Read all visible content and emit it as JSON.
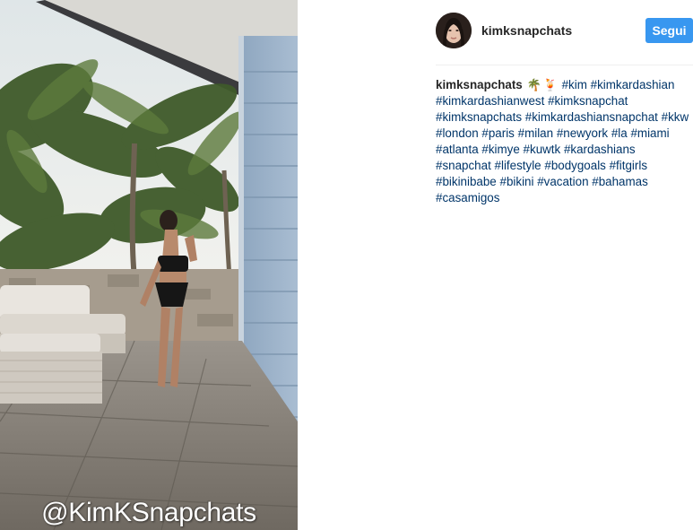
{
  "post": {
    "username": "kimksnapchats",
    "follow_label": "Segui",
    "watermark": "@KimKSnapchats",
    "avatar_icon": "profile-avatar",
    "caption": {
      "username": "kimksnapchats",
      "emojis": [
        "🌴",
        "🍹"
      ],
      "hashtags": [
        "#kim",
        "#kimkardashian",
        "#kimkardashianwest",
        "#kimksnapchat",
        "#kimksnapchats",
        "#kimkardashiansnapchat",
        "#kkw",
        "#london",
        "#paris",
        "#milan",
        "#newyork",
        "#la",
        "#miami",
        "#atlanta",
        "#kimye",
        "#kuwtk",
        "#kardashians",
        "#snapchat",
        "#lifestyle",
        "#bodygoals",
        "#fitgirls",
        "#bikinibabe",
        "#bikini",
        "#vacation",
        "#bahamas",
        "#casamigos"
      ]
    }
  },
  "colors": {
    "accent": "#3897f0",
    "hashtag": "#003569",
    "text": "#262626",
    "divider": "#efefef"
  }
}
